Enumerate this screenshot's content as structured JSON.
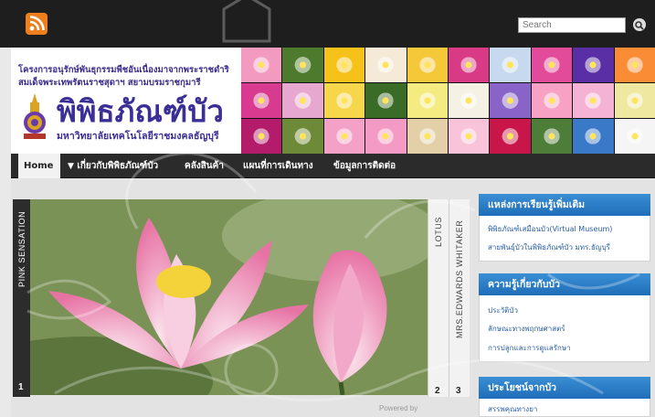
{
  "search": {
    "placeholder": "Search"
  },
  "header": {
    "tagline_line1": "โครงการอนุรักษ์พันธุกรรมพืชอันเนื่องมาจากพระราชดำริ",
    "tagline_line2": "สมเด็จพระเทพรัตนราชสุดาฯ สยามบรมราชกุมารี",
    "brand": "พิพิธภัณฑ์บัว",
    "brand_sub": "มหาวิทยาลัยเทคโนโลยีราชมงคลธัญบุรี"
  },
  "nav": {
    "home": "Home",
    "about": "เกี่ยวกับพิพิธภัณฑ์บัว",
    "products": "คลังสินค้า",
    "map": "แผนที่การเดินทาง",
    "contact": "ข้อมูลการติดต่อ"
  },
  "slider": {
    "left_tab": "PINK SENSATION",
    "left_num": "1",
    "tab2_label": "LOTUS",
    "tab2_num": "2",
    "tab3_label": "MRS.EDWARDS WHITAKER",
    "tab3_num": "3",
    "powered": "Powered by"
  },
  "sidebar": {
    "widget1_title": "แหล่งการเรียนรู้เพิ่มเติม",
    "widget1_links": [
      "พิพิธภัณฑ์เสมือนบัว(Virtual Museum)",
      "สายพันธุ์บัวในพิพิธภัณฑ์บัว มทร.ธัญบุรี"
    ],
    "widget2_title": "ความรู้เกี่ยวกับบัว",
    "widget2_links": [
      "ประวัติบัว",
      "ลักษณะทางพฤกษศาสตร์",
      "การปลูกและการดูแลรักษา"
    ],
    "widget3_title": "ประโยชน์จากบัว",
    "widget3_links": [
      "สรรพคุณทางยา"
    ]
  },
  "colors": {
    "topbar": "#1e1e1e",
    "rss": "#ef7e1c",
    "brand": "#3a2f96",
    "widget_title": "#1f6db8",
    "link": "#2a5fa6"
  }
}
